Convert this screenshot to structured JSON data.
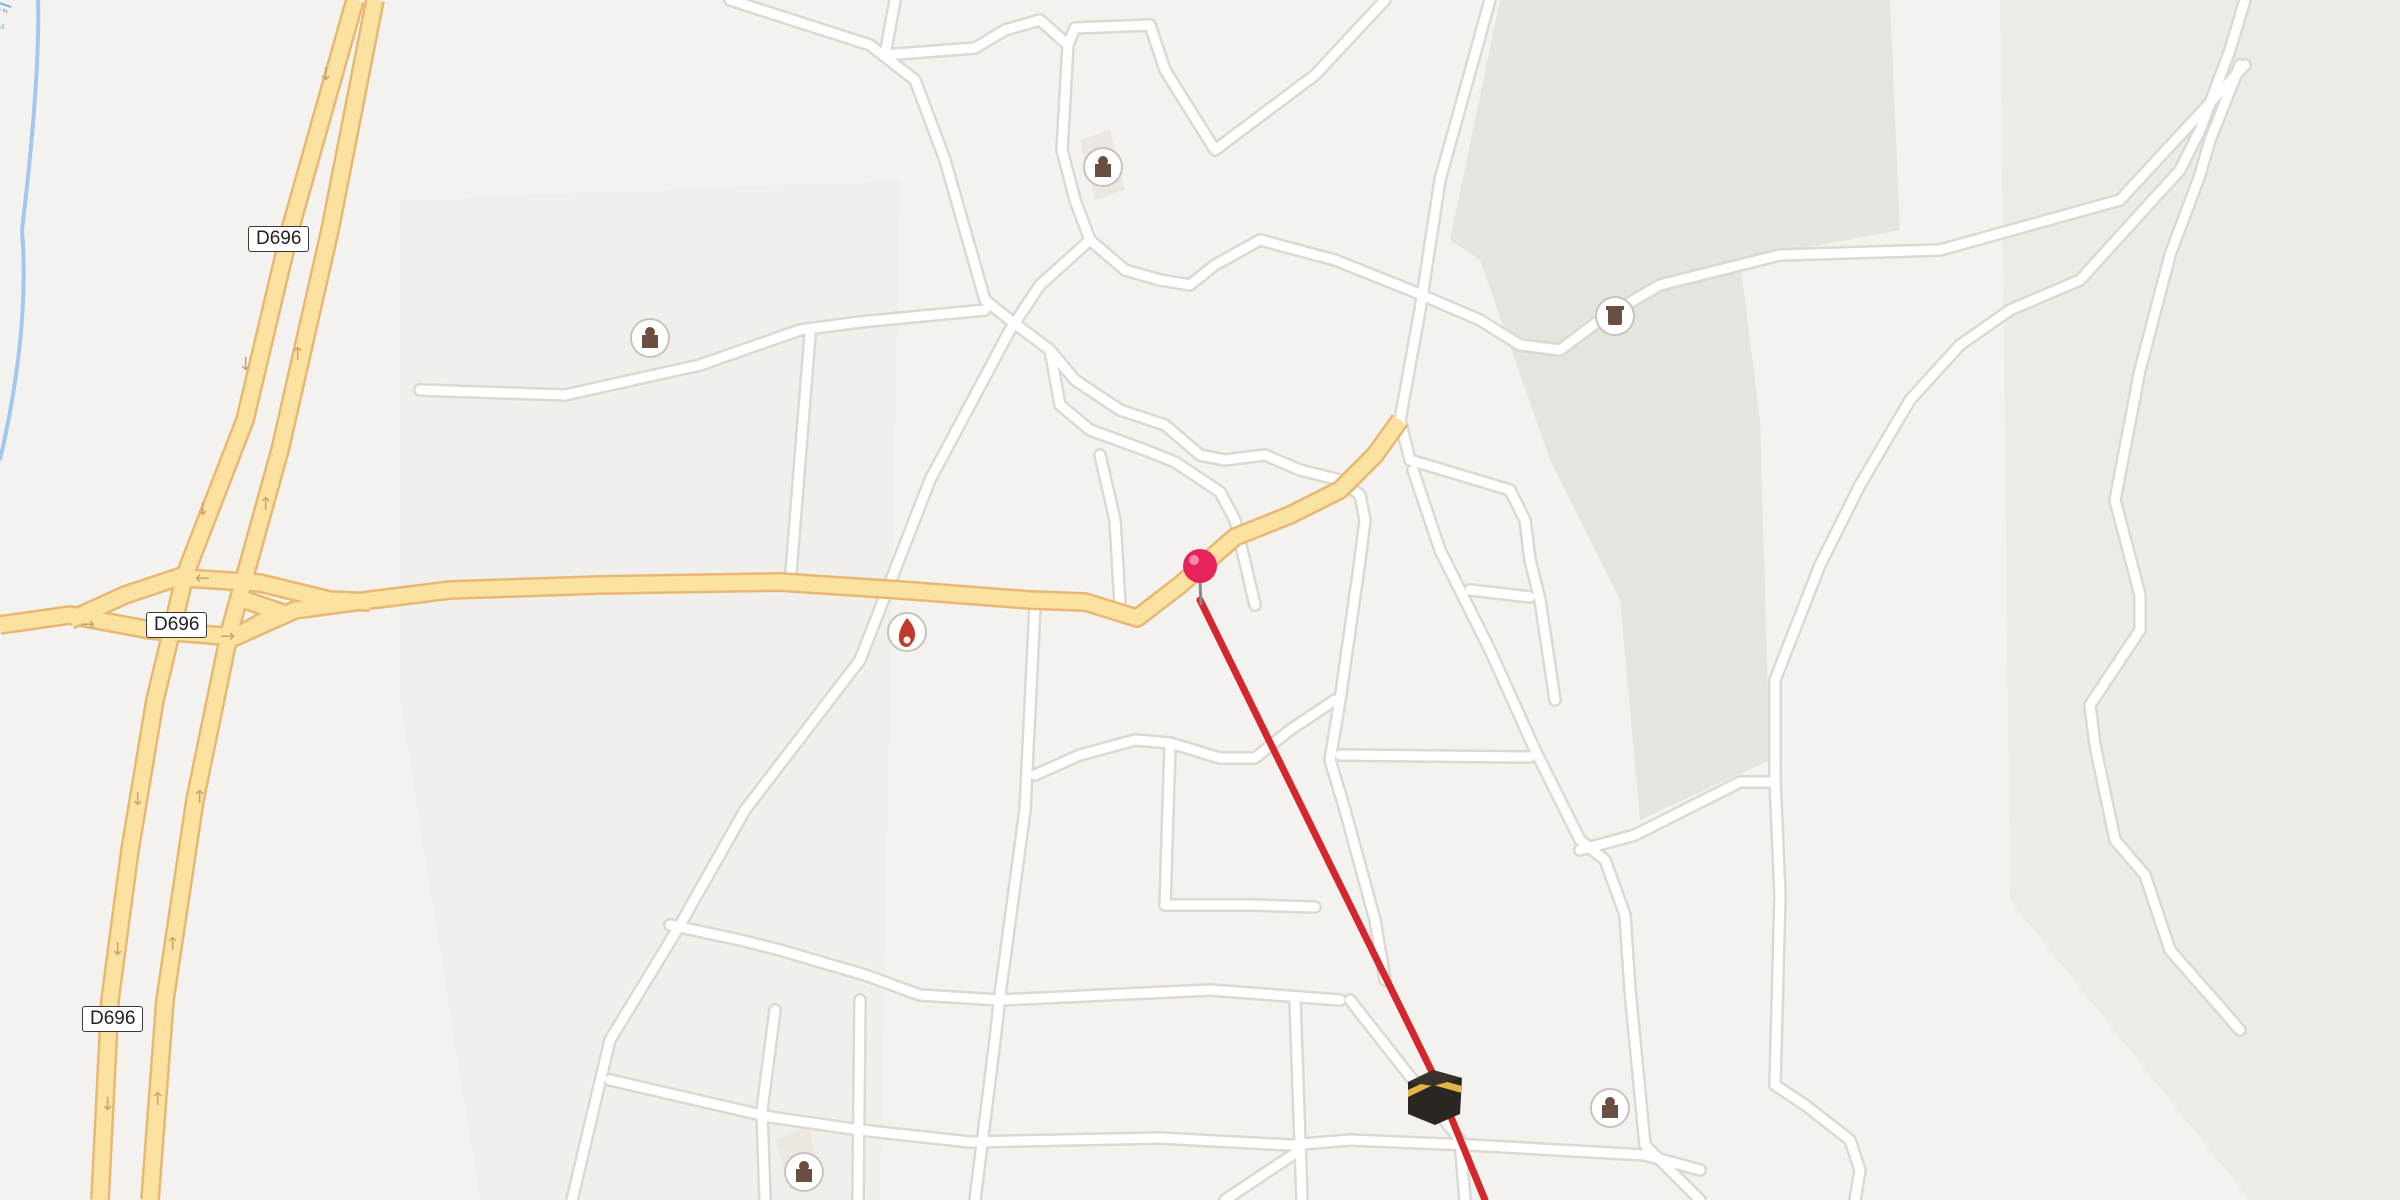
{
  "map": {
    "road_labels": [
      "D696",
      "D696",
      "D696"
    ],
    "river_label": "ﺔﻴﺋﺍ",
    "colors": {
      "background": "#f4f2ef",
      "green_area": "#e3e6df",
      "park_area": "#eceee6",
      "minor_road": "#ffffff",
      "primary_road": "#fbe2a1",
      "primary_road_casing": "#e8b873",
      "river": "#a3c8ef",
      "route_line": "#d4262d",
      "pin": "#e8235b"
    },
    "poi_icons": [
      "place-of-worship-icon",
      "place-of-worship-icon",
      "place-of-worship-icon",
      "place-of-worship-icon",
      "fire-station-icon",
      "cemetery-icon",
      "kaaba-icon"
    ],
    "marker": "location-pin-icon"
  }
}
